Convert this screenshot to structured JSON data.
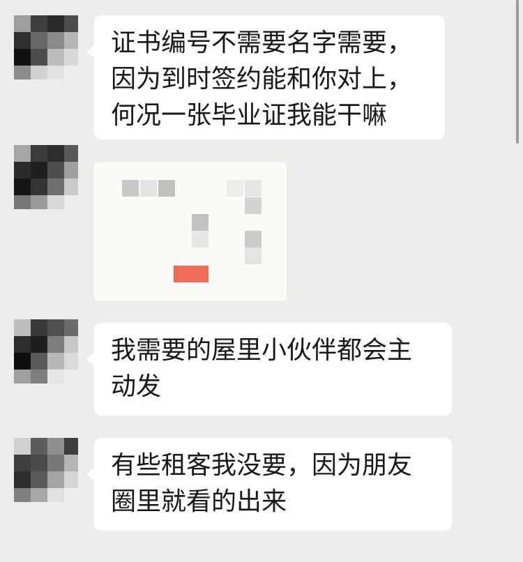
{
  "colors": {
    "background": "#ececec",
    "bubble": "#ffffff",
    "text": "#181818",
    "image_accent": "#f06a57",
    "scrollbar": "#9b9b9b"
  },
  "messages": [
    {
      "avatar_icon": "pixelated-avatar-icon",
      "text": "证书编号不需要名字需要，\n因为到时签约能和你对上，\n何况一张毕业证我能干嘛"
    },
    {
      "avatar_icon": "pixelated-avatar-icon",
      "image_icon": "pixelated-image-icon"
    },
    {
      "avatar_icon": "pixelated-avatar-icon",
      "text": "我需要的屋里小伙伴都会主\n动发"
    },
    {
      "avatar_icon": "pixelated-avatar-icon",
      "text": "有些租客我没要，因为朋友\n圈里就看的出来"
    }
  ]
}
